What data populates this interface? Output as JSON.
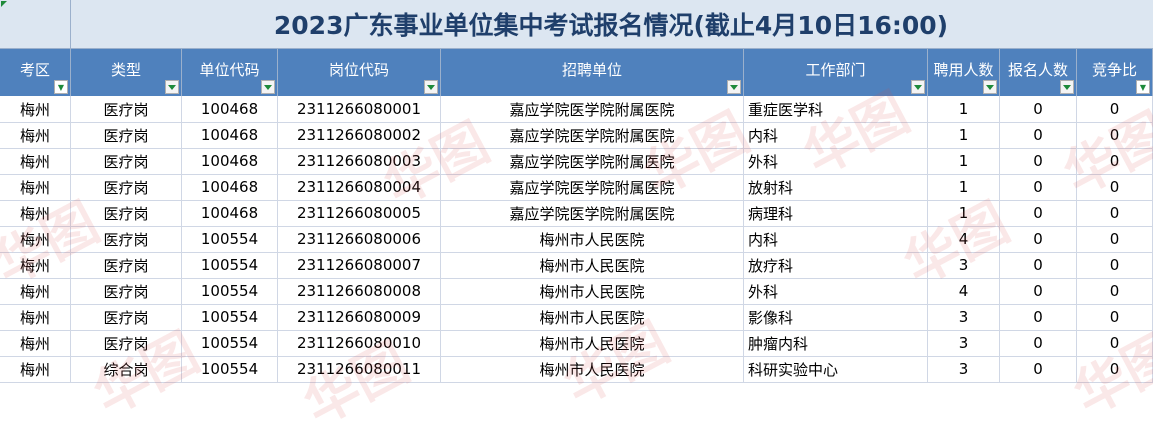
{
  "title": "2023广东事业单位集中考试报名情况(截止4月10日16:00)",
  "columns": [
    "考区",
    "类型",
    "单位代码",
    "岗位代码",
    "招聘单位",
    "工作部门",
    "聘用人数",
    "报名人数",
    "竞争比"
  ],
  "rows": [
    [
      "梅州",
      "医疗岗",
      "100468",
      "2311266080001",
      "嘉应学院医学院附属医院",
      "重症医学科",
      "1",
      "0",
      "0"
    ],
    [
      "梅州",
      "医疗岗",
      "100468",
      "2311266080002",
      "嘉应学院医学院附属医院",
      "内科",
      "1",
      "0",
      "0"
    ],
    [
      "梅州",
      "医疗岗",
      "100468",
      "2311266080003",
      "嘉应学院医学院附属医院",
      "外科",
      "1",
      "0",
      "0"
    ],
    [
      "梅州",
      "医疗岗",
      "100468",
      "2311266080004",
      "嘉应学院医学院附属医院",
      "放射科",
      "1",
      "0",
      "0"
    ],
    [
      "梅州",
      "医疗岗",
      "100468",
      "2311266080005",
      "嘉应学院医学院附属医院",
      "病理科",
      "1",
      "0",
      "0"
    ],
    [
      "梅州",
      "医疗岗",
      "100554",
      "2311266080006",
      "梅州市人民医院",
      "内科",
      "4",
      "0",
      "0"
    ],
    [
      "梅州",
      "医疗岗",
      "100554",
      "2311266080007",
      "梅州市人民医院",
      "放疗科",
      "3",
      "0",
      "0"
    ],
    [
      "梅州",
      "医疗岗",
      "100554",
      "2311266080008",
      "梅州市人民医院",
      "外科",
      "4",
      "0",
      "0"
    ],
    [
      "梅州",
      "医疗岗",
      "100554",
      "2311266080009",
      "梅州市人民医院",
      "影像科",
      "3",
      "0",
      "0"
    ],
    [
      "梅州",
      "医疗岗",
      "100554",
      "2311266080010",
      "梅州市人民医院",
      "肿瘤内科",
      "3",
      "0",
      "0"
    ],
    [
      "梅州",
      "综合岗",
      "100554",
      "2311266080011",
      "梅州市人民医院",
      "科研实验中心",
      "3",
      "0",
      "0"
    ]
  ],
  "watermark": "华图"
}
